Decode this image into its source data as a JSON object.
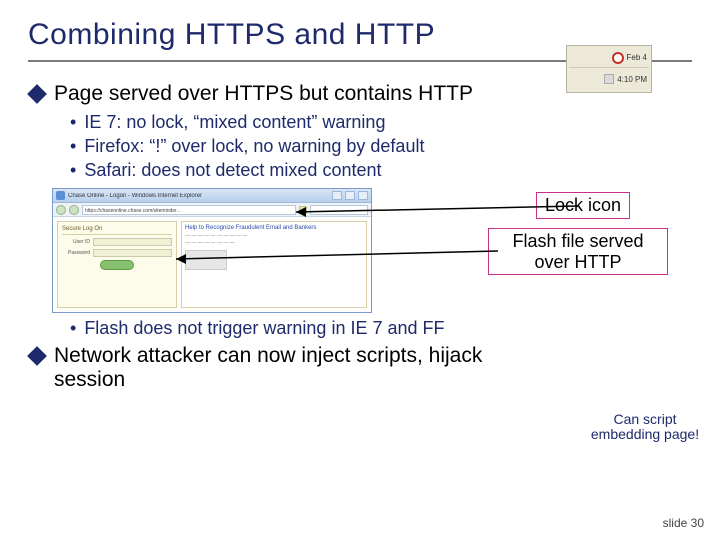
{
  "title": "Combining HTTPS and HTTP",
  "point1": {
    "heading": "Page served over HTTPS but contains HTTP",
    "bullets": [
      "IE 7: no lock, “mixed content” warning",
      "Firefox: “!” over lock, no warning by default",
      "Safari: does not detect mixed content"
    ],
    "flash_bullet": "Flash does not trigger warning in IE 7 and FF"
  },
  "point2": {
    "heading": "Network attacker can now inject scripts, hijack session"
  },
  "callouts": {
    "lock": "Lock icon",
    "flash": "Flash file served over HTTP",
    "script_note": "Can script embedding page!"
  },
  "browser_mock": {
    "title": "Chase Online - Logon - Windows Internet Explorer",
    "url": "https://chaseonline.chase.com/siteminder...",
    "left_panel_title": "Secure Log On",
    "field1": "User ID",
    "field2": "Password",
    "right_head": "Help to Recognize Fraudulent Email and Bankers"
  },
  "taskbar_mock": {
    "date": "Feb 4",
    "time": "4:10 PM"
  },
  "footer": "slide 30"
}
